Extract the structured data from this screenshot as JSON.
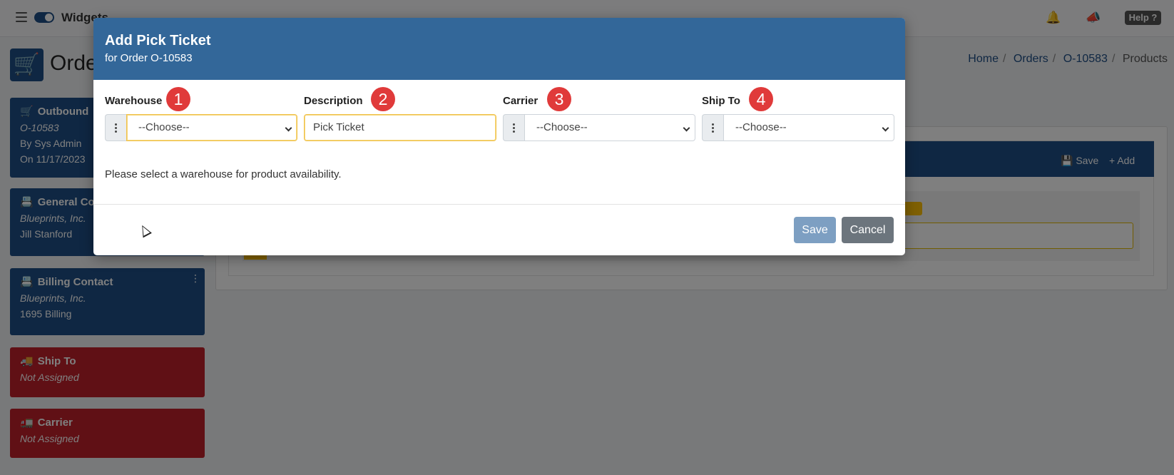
{
  "app": {
    "brand": "Widgets",
    "help_label": "Help",
    "help_icon": "question-icon"
  },
  "page": {
    "title": "Orde",
    "breadcrumb": [
      "Home",
      "Orders",
      "O-10583",
      "Products"
    ]
  },
  "sidebar": {
    "cards": [
      {
        "title": "Outbound",
        "lines": [
          "O-10583",
          "By Sys Admin",
          "On 11/17/2023"
        ],
        "icon": "cart-icon"
      },
      {
        "title": "General Co",
        "lines": [
          "Blueprints, Inc.",
          "Jill Stanford"
        ],
        "icon": "id-card-icon"
      },
      {
        "title": "Billing Contact",
        "lines": [
          "Blueprints, Inc.",
          "1695 Billing"
        ],
        "icon": "id-card-icon"
      },
      {
        "title": "Ship To",
        "lines": [
          "Not Assigned"
        ],
        "icon": "truck-icon"
      },
      {
        "title": "Carrier",
        "lines": [
          "Not Assigned"
        ],
        "icon": "dolly-icon"
      }
    ]
  },
  "panel": {
    "save_label": "Save",
    "add_label": "Add"
  },
  "modal": {
    "title": "Add Pick Ticket",
    "subtitle": "for Order O-10583",
    "fields": {
      "warehouse": {
        "label": "Warehouse",
        "badge": "1",
        "value": "--Choose--"
      },
      "description": {
        "label": "Description",
        "badge": "2",
        "value": "Pick Ticket"
      },
      "carrier": {
        "label": "Carrier",
        "badge": "3",
        "value": "--Choose--"
      },
      "ship_to": {
        "label": "Ship To",
        "badge": "4",
        "value": "--Choose--"
      }
    },
    "help_text": "Please select a warehouse for product availability.",
    "save_label": "Save",
    "cancel_label": "Cancel"
  },
  "colors": {
    "primary": "#336799",
    "card_blue": "#1f4f86",
    "card_red": "#c0202a",
    "badge_red": "#e03a3a",
    "focus_yellow": "#f0c14b"
  }
}
